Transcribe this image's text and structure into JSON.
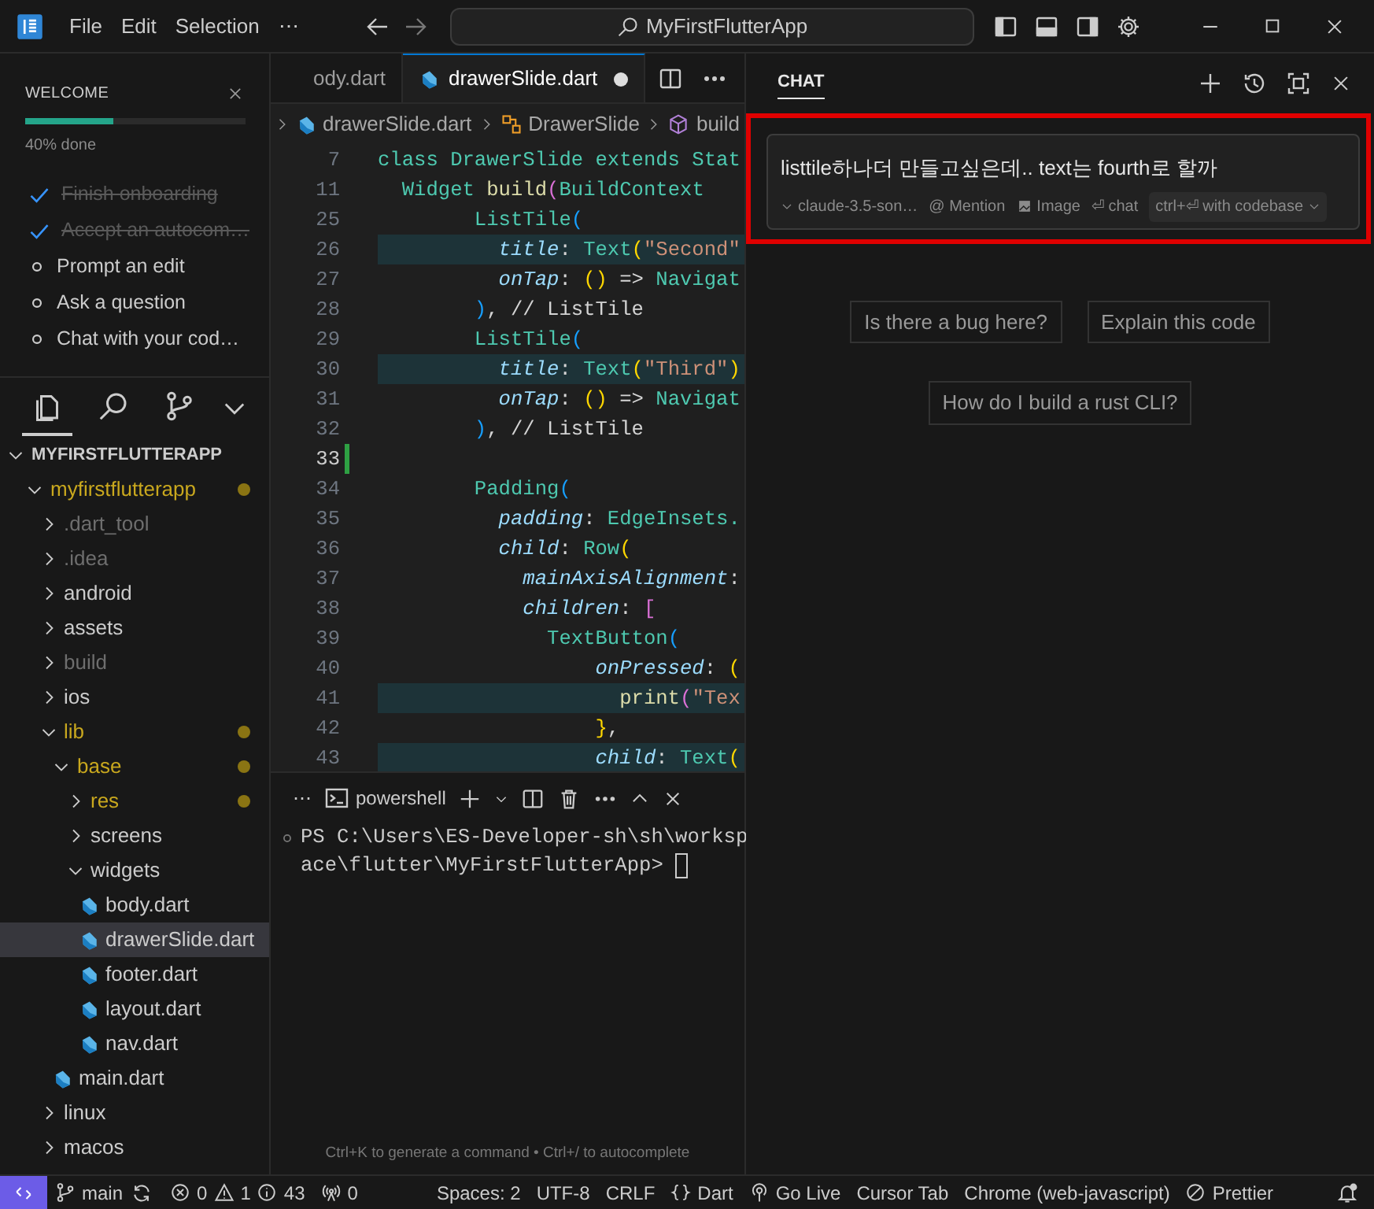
{
  "title_bar": {
    "menus": [
      "File",
      "Edit",
      "Selection",
      "⋯"
    ],
    "search": "MyFirstFlutterApp"
  },
  "welcome": {
    "title": "WELCOME",
    "level": 0.4,
    "progress_text": "40% done",
    "steps": [
      {
        "label": "Finish onboarding",
        "done": true
      },
      {
        "label": "Accept an autocom…",
        "done": true
      },
      {
        "label": "Prompt an edit",
        "done": false
      },
      {
        "label": "Ask a question",
        "done": false
      },
      {
        "label": "Chat with your cod…",
        "done": false
      }
    ]
  },
  "activity_bar": [
    {
      "kind": "explorer",
      "selected": true
    },
    {
      "kind": "search",
      "selected": false
    },
    {
      "kind": "source-control",
      "selected": false
    }
  ],
  "explorer": {
    "root": "MYFIRSTFLUTTERAPP",
    "expanded": true,
    "tree": [
      {
        "name": "myfirstflutterapp",
        "kind": "folder",
        "expanded": true,
        "modified": true,
        "ignored": false,
        "selected": false,
        "children": [
          {
            "name": ".dart_tool",
            "kind": "folder",
            "expanded": false,
            "modified": false,
            "ignored": true,
            "selected": false
          },
          {
            "name": ".idea",
            "kind": "folder",
            "expanded": false,
            "modified": false,
            "ignored": true,
            "selected": false
          },
          {
            "name": "android",
            "kind": "folder",
            "expanded": false,
            "modified": false,
            "ignored": false,
            "selected": false
          },
          {
            "name": "assets",
            "kind": "folder",
            "expanded": false,
            "modified": false,
            "ignored": false,
            "selected": false
          },
          {
            "name": "build",
            "kind": "folder",
            "expanded": false,
            "modified": false,
            "ignored": true,
            "selected": false
          },
          {
            "name": "ios",
            "kind": "folder",
            "expanded": false,
            "modified": false,
            "ignored": false,
            "selected": false
          },
          {
            "name": "lib",
            "kind": "folder",
            "expanded": true,
            "modified": true,
            "ignored": false,
            "selected": false,
            "children": [
              {
                "name": "base",
                "kind": "folder",
                "expanded": true,
                "modified": true,
                "ignored": false,
                "selected": false,
                "children": [
                  {
                    "name": "res",
                    "kind": "folder",
                    "expanded": false,
                    "modified": true,
                    "ignored": false,
                    "selected": false
                  },
                  {
                    "name": "screens",
                    "kind": "folder",
                    "expanded": false,
                    "modified": false,
                    "ignored": false,
                    "selected": false
                  },
                  {
                    "name": "widgets",
                    "kind": "folder",
                    "expanded": true,
                    "modified": false,
                    "ignored": false,
                    "selected": false,
                    "children": [
                      {
                        "name": "body.dart",
                        "kind": "file",
                        "modified": false,
                        "ignored": false,
                        "selected": false
                      },
                      {
                        "name": "drawerSlide.dart",
                        "kind": "file",
                        "modified": false,
                        "ignored": false,
                        "selected": true
                      },
                      {
                        "name": "footer.dart",
                        "kind": "file",
                        "modified": false,
                        "ignored": false,
                        "selected": false
                      },
                      {
                        "name": "layout.dart",
                        "kind": "file",
                        "modified": false,
                        "ignored": false,
                        "selected": false
                      },
                      {
                        "name": "nav.dart",
                        "kind": "file",
                        "modified": false,
                        "ignored": false,
                        "selected": false
                      }
                    ]
                  }
                ]
              },
              {
                "name": "main.dart",
                "kind": "file",
                "modified": false,
                "ignored": false,
                "selected": false
              }
            ]
          },
          {
            "name": "linux",
            "kind": "folder",
            "expanded": false,
            "modified": false,
            "ignored": false,
            "selected": false
          },
          {
            "name": "macos",
            "kind": "folder",
            "expanded": false,
            "modified": false,
            "ignored": false,
            "selected": false
          }
        ]
      }
    ]
  },
  "editor": {
    "tabs": [
      {
        "label": "ody.dart",
        "selected": false,
        "dirty": false
      },
      {
        "label": "drawerSlide.dart",
        "selected": true,
        "dirty": true
      }
    ],
    "breadcrumb": [
      "drawerSlide.dart",
      "DrawerSlide",
      "build"
    ],
    "lines": [
      {
        "number": "7",
        "highlighted": false,
        "current": false,
        "tokens": [
          {
            "text": "class ",
            "kind": "kw"
          },
          {
            "text": "DrawerSlide ",
            "kind": "type"
          },
          {
            "text": "extends ",
            "kind": "kw"
          },
          {
            "text": "Stat",
            "kind": "type"
          }
        ]
      },
      {
        "number": "11",
        "highlighted": false,
        "current": false,
        "tokens": [
          {
            "text": "  Widget ",
            "kind": "type"
          },
          {
            "text": "build",
            "kind": "fn"
          },
          {
            "text": "(",
            "kind": "b2"
          },
          {
            "text": "BuildContext",
            "kind": "type"
          }
        ]
      },
      {
        "number": "25",
        "highlighted": false,
        "current": false,
        "tokens": [
          {
            "text": "        ListTile",
            "kind": "type"
          },
          {
            "text": "(",
            "kind": "b3"
          }
        ]
      },
      {
        "number": "26",
        "highlighted": true,
        "current": false,
        "tokens": [
          {
            "text": "          title",
            "kind": "prop"
          },
          {
            "text": ": ",
            "kind": "punc"
          },
          {
            "text": "Text",
            "kind": "type"
          },
          {
            "text": "(",
            "kind": "b1"
          },
          {
            "text": "\"Second\"",
            "kind": "str"
          }
        ]
      },
      {
        "number": "27",
        "highlighted": false,
        "current": false,
        "tokens": [
          {
            "text": "          onTap",
            "kind": "prop"
          },
          {
            "text": ": ",
            "kind": "punc"
          },
          {
            "text": "()",
            "kind": "b1"
          },
          {
            "text": " => ",
            "kind": "punc"
          },
          {
            "text": "Navigat",
            "kind": "type"
          }
        ]
      },
      {
        "number": "28",
        "highlighted": false,
        "current": false,
        "tokens": [
          {
            "text": "        )",
            "kind": "b3"
          },
          {
            "text": ", // ListTile",
            "kind": "punc"
          }
        ]
      },
      {
        "number": "29",
        "highlighted": false,
        "current": false,
        "tokens": [
          {
            "text": "        ListTile",
            "kind": "type"
          },
          {
            "text": "(",
            "kind": "b3"
          }
        ]
      },
      {
        "number": "30",
        "highlighted": true,
        "current": false,
        "tokens": [
          {
            "text": "          title",
            "kind": "prop"
          },
          {
            "text": ": ",
            "kind": "punc"
          },
          {
            "text": "Text",
            "kind": "type"
          },
          {
            "text": "(",
            "kind": "b1"
          },
          {
            "text": "\"Third\"",
            "kind": "str"
          },
          {
            "text": ")",
            "kind": "b1"
          }
        ]
      },
      {
        "number": "31",
        "highlighted": false,
        "current": false,
        "tokens": [
          {
            "text": "          onTap",
            "kind": "prop"
          },
          {
            "text": ": ",
            "kind": "punc"
          },
          {
            "text": "()",
            "kind": "b1"
          },
          {
            "text": " => ",
            "kind": "punc"
          },
          {
            "text": "Navigat",
            "kind": "type"
          }
        ]
      },
      {
        "number": "32",
        "highlighted": false,
        "current": false,
        "tokens": [
          {
            "text": "        )",
            "kind": "b3"
          },
          {
            "text": ", // ListTile",
            "kind": "punc"
          }
        ]
      },
      {
        "number": "33",
        "highlighted": false,
        "current": true
      },
      {
        "number": "34",
        "highlighted": false,
        "current": false,
        "tokens": [
          {
            "text": "        Padding",
            "kind": "type"
          },
          {
            "text": "(",
            "kind": "b3"
          }
        ]
      },
      {
        "number": "35",
        "highlighted": false,
        "current": false,
        "tokens": [
          {
            "text": "          padding",
            "kind": "prop"
          },
          {
            "text": ": ",
            "kind": "punc"
          },
          {
            "text": "EdgeInsets.",
            "kind": "type"
          }
        ]
      },
      {
        "number": "36",
        "highlighted": false,
        "current": false,
        "tokens": [
          {
            "text": "          child",
            "kind": "prop"
          },
          {
            "text": ": ",
            "kind": "punc"
          },
          {
            "text": "Row",
            "kind": "type"
          },
          {
            "text": "(",
            "kind": "b1"
          }
        ]
      },
      {
        "number": "37",
        "highlighted": false,
        "current": false,
        "tokens": [
          {
            "text": "            mainAxisAlignment",
            "kind": "prop"
          },
          {
            "text": ":",
            "kind": "punc"
          }
        ]
      },
      {
        "number": "38",
        "highlighted": false,
        "current": false,
        "tokens": [
          {
            "text": "            children",
            "kind": "prop"
          },
          {
            "text": ": ",
            "kind": "punc"
          },
          {
            "text": "[",
            "kind": "b2"
          }
        ]
      },
      {
        "number": "39",
        "highlighted": false,
        "current": false,
        "tokens": [
          {
            "text": "              TextButton",
            "kind": "type"
          },
          {
            "text": "(",
            "kind": "b3"
          }
        ]
      },
      {
        "number": "40",
        "highlighted": false,
        "current": false,
        "tokens": [
          {
            "text": "                  onPressed",
            "kind": "prop"
          },
          {
            "text": ": ",
            "kind": "punc"
          },
          {
            "text": "(",
            "kind": "b1"
          }
        ]
      },
      {
        "number": "41",
        "highlighted": true,
        "current": false,
        "tokens": [
          {
            "text": "                    print",
            "kind": "fn"
          },
          {
            "text": "(",
            "kind": "b2"
          },
          {
            "text": "\"Tex",
            "kind": "str"
          }
        ]
      },
      {
        "number": "42",
        "highlighted": false,
        "current": false,
        "tokens": [
          {
            "text": "                  }",
            "kind": "b1"
          },
          {
            "text": ",",
            "kind": "punc"
          }
        ]
      },
      {
        "number": "43",
        "highlighted": true,
        "current": false,
        "tokens": [
          {
            "text": "                  child",
            "kind": "prop"
          },
          {
            "text": ": ",
            "kind": "punc"
          },
          {
            "text": "Text",
            "kind": "type"
          },
          {
            "text": "(",
            "kind": "b1"
          }
        ]
      }
    ]
  },
  "terminal": {
    "more": "⋯",
    "tab": "powershell",
    "lines": [
      "PS C:\\Users\\ES-Developer-sh\\sh\\worksp",
      "ace\\flutter\\MyFirstFlutterApp>"
    ],
    "hint": "Ctrl+K to generate a command • Ctrl+/ to autocomplete"
  },
  "chat": {
    "tab": "CHAT",
    "input": {
      "value": "listtile하나더 만들고싶은데.. text는 fourth로 할까",
      "highlighted": true,
      "model": "claude-3.5-son…",
      "mention": "@ Mention",
      "image": "Image",
      "submit": "⏎ chat",
      "codebase": "ctrl+⏎ with codebase"
    },
    "suggestions": [
      [
        "Is there a bug here?",
        "Explain this code"
      ],
      [
        "How do I build a rust CLI?"
      ]
    ]
  },
  "status_bar": [
    {
      "kind": "remote"
    },
    {
      "kind": "branch",
      "text": "main"
    },
    {
      "kind": "sync"
    },
    {
      "kind": "problems",
      "errors": "0",
      "warnings": "1",
      "info": "43"
    },
    {
      "kind": "ports",
      "text": "0"
    },
    {
      "kind": "text",
      "text": "Spaces: 2"
    },
    {
      "kind": "text",
      "text": "UTF-8"
    },
    {
      "kind": "text",
      "text": "CRLF"
    },
    {
      "kind": "language",
      "text": "Dart"
    },
    {
      "kind": "live",
      "text": "Go Live"
    },
    {
      "kind": "text",
      "text": "Cursor Tab"
    },
    {
      "kind": "text",
      "text": "Chrome (web-javascript)"
    },
    {
      "kind": "prettier",
      "text": "Prettier"
    },
    {
      "kind": "bell"
    }
  ]
}
